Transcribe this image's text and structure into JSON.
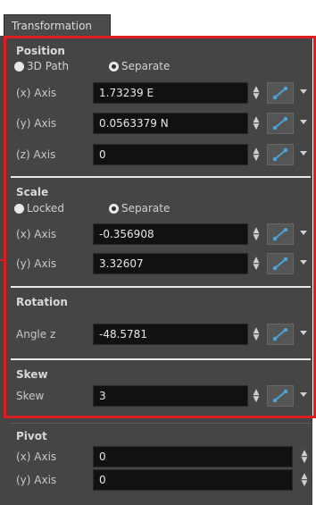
{
  "tab": {
    "label": "Transformation"
  },
  "position": {
    "title": "Position",
    "modes": [
      "3D Path",
      "Separate"
    ],
    "selected_mode": "Separate",
    "rows": [
      {
        "label": "(x) Axis",
        "value": "1.73239 E"
      },
      {
        "label": "(y) Axis",
        "value": "0.0563379 N"
      },
      {
        "label": "(z) Axis",
        "value": "0"
      }
    ]
  },
  "scale": {
    "title": "Scale",
    "modes": [
      "Locked",
      "Separate"
    ],
    "selected_mode": "Separate",
    "rows": [
      {
        "label": "(x) Axis",
        "value": "-0.356908"
      },
      {
        "label": "(y) Axis",
        "value": "3.32607"
      }
    ]
  },
  "rotation": {
    "title": "Rotation",
    "rows": [
      {
        "label": "Angle z",
        "value": "-48.5781"
      }
    ]
  },
  "skew": {
    "title": "Skew",
    "rows": [
      {
        "label": "Skew",
        "value": "3"
      }
    ]
  },
  "pivot": {
    "title": "Pivot",
    "rows": [
      {
        "label": "(x) Axis",
        "value": "0"
      },
      {
        "label": "(y) Axis",
        "value": "0"
      }
    ]
  },
  "icons": {
    "spinner": "up-down-arrows-icon",
    "function_curve": "function-curve-icon",
    "dropdown": "chevron-down-icon"
  },
  "colors": {
    "panel_bg": "#454545",
    "field_bg": "#111111",
    "highlight_box": "#dc1e1e"
  }
}
